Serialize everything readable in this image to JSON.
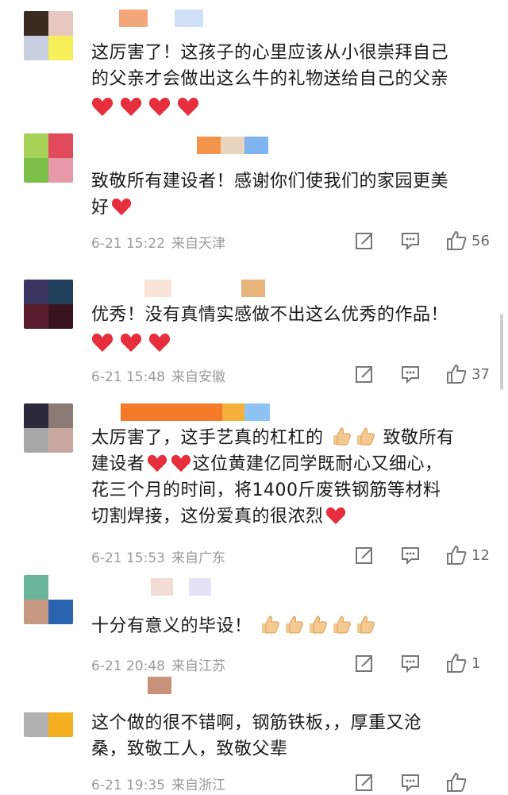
{
  "comments": [
    {
      "avatar_colors": [
        "#3a2a20",
        "#e8c9c0",
        "#c9cfe0",
        "#f5ef5a"
      ],
      "name_colors": [
        "#f3a77a",
        "#ffffff",
        "#cfe0f6"
      ],
      "lines": [
        "这厉害了！这孩子的心里应该从小很崇拜自己",
        "的父亲才会做出这么牛的礼物送给自己的父亲"
      ],
      "hearts": 4,
      "date": "",
      "location": "",
      "likes": ""
    },
    {
      "avatar_colors": [
        "#a8d45a",
        "#e04a5a",
        "#7cc04a",
        "#e89aa8"
      ],
      "name_colors": [
        "#f4944a",
        "#e9d4c0",
        "#7fb4f0"
      ],
      "lines": [
        "致敬所有建设者！感谢你们使我们的家园更美",
        "好"
      ],
      "hearts": 1,
      "date": "6-21 15:22",
      "location": "来自天津",
      "likes": "56"
    },
    {
      "avatar_colors": [
        "#3a3460",
        "#1e3e5a",
        "#5a1e2e",
        "#3a1420"
      ],
      "name_colors": [
        "#f9e3d6",
        "#ffffff",
        "#e6b47a"
      ],
      "lines": [
        "优秀！没有真情实感做不出这么优秀的作品！"
      ],
      "hearts": 3,
      "date": "6-21 15:48",
      "location": "来自安徽",
      "likes": "37"
    },
    {
      "avatar_colors": [
        "#2a2a3a",
        "#8c7a74",
        "#a8a8aa",
        "#caa6a0"
      ],
      "name_colors": [
        "#f47a2a",
        "#f4b03a",
        "#8ec3f5"
      ],
      "lines": [
        "太厉害了，这手艺真的杠杠的",
        "致敬所有",
        "建设者",
        "这位黄建亿同学既耐心又细心，",
        "花三个月的时间，将1400斤废铁钢筋等材料",
        "切割焊接，这份爱真的很浓烈"
      ],
      "hearts": 0,
      "date": "6-21 15:53",
      "location": "来自广东",
      "likes": "12"
    },
    {
      "avatar_colors": [
        "#6ab49a",
        "#ffffff",
        "#c89a84",
        "#2a64b0"
      ],
      "name_colors": [
        "#f2dcd4",
        "#ffffff",
        "#e4e2f6"
      ],
      "lines": [
        "十分有意义的毕设！"
      ],
      "hearts": 0,
      "date": "6-21 20:48",
      "location": "来自江苏",
      "likes": "1"
    },
    {
      "avatar_colors": [
        "#ffffff",
        "#ffffff",
        "#b0b0b0",
        "#f4b020"
      ],
      "name_colors": [
        "#c8927a"
      ],
      "lines": [
        "这个做的很不错啊，钢筋铁板，，厚重又沧",
        "桑，致敬工人，致敬父辈"
      ],
      "hearts": 0,
      "date": "6-21 19:35",
      "location": "来自浙江",
      "likes": ""
    }
  ],
  "icons": {
    "share": "share-icon",
    "comment": "comment-icon",
    "like": "thumbs-up-icon",
    "heart": "red-heart-icon",
    "thumb": "thumbs-up-emoji-icon"
  },
  "colors": {
    "heart": "#e62e3c",
    "meta": "#9a9a9a",
    "text": "#1a1a1a"
  }
}
